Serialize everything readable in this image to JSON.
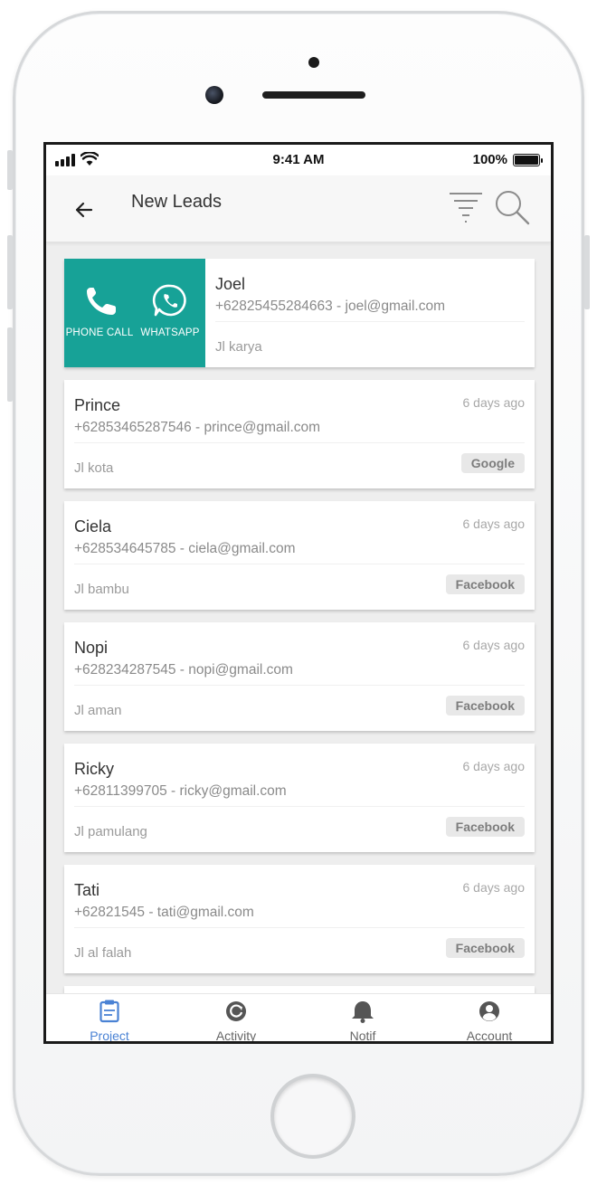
{
  "status_bar": {
    "time": "9:41 AM",
    "battery_percent": "100%",
    "icons": [
      "cellular-signal-icon",
      "wifi-icon",
      "battery-icon"
    ]
  },
  "app_bar": {
    "title": "New Leads",
    "back_icon": "arrow-left-icon",
    "filter_icon": "filter-icon",
    "search_icon": "search-icon"
  },
  "swipe_actions": [
    {
      "label": "PHONE CALL",
      "icon": "phone-icon"
    },
    {
      "label": "WHATSAPP",
      "icon": "whatsapp-icon"
    }
  ],
  "leads": [
    {
      "name": "Joel",
      "contact": "+62825455284663 - joel@gmail.com",
      "address": "Jl karya"
    },
    {
      "name": "Prince",
      "contact": "+62853465287546 - prince@gmail.com",
      "address": "Jl kota",
      "time": "6 days ago",
      "source": "Google"
    },
    {
      "name": "Ciela",
      "contact": "+628534645785 - ciela@gmail.com",
      "address": "Jl bambu",
      "time": "6 days ago",
      "source": "Facebook"
    },
    {
      "name": "Nopi",
      "contact": "+628234287545 - nopi@gmail.com",
      "address": "Jl aman",
      "time": "6 days ago",
      "source": "Facebook"
    },
    {
      "name": "Ricky",
      "contact": "+62811399705 - ricky@gmail.com",
      "address": "Jl pamulang",
      "time": "6 days ago",
      "source": "Facebook"
    },
    {
      "name": "Tati",
      "contact": "+62821545 - tati@gmail.com",
      "address": "Jl al falah",
      "time": "6 days ago",
      "source": "Facebook"
    }
  ],
  "bottom_nav": [
    {
      "label": "Project",
      "icon": "clipboard-icon",
      "active": true
    },
    {
      "label": "Activity",
      "icon": "activity-icon",
      "active": false
    },
    {
      "label": "Notif",
      "icon": "bell-icon",
      "active": false
    },
    {
      "label": "Account",
      "icon": "account-icon",
      "active": false
    }
  ],
  "colors": {
    "swipe_action_bg": "#17a297",
    "active_nav": "#4a82d4",
    "source_badge_bg": "#e8e8e8"
  }
}
